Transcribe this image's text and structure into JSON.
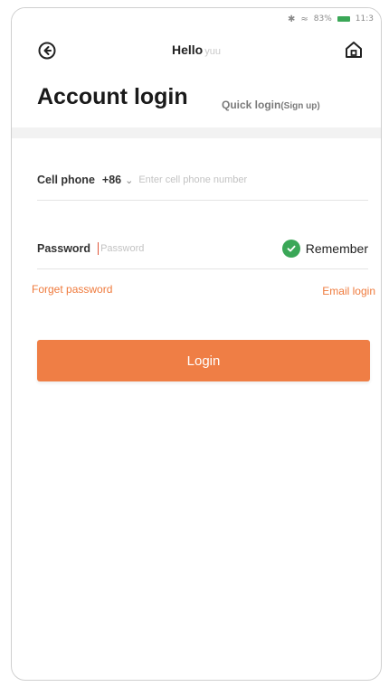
{
  "status_bar": {
    "battery": "83%",
    "time": "11:3"
  },
  "header": {
    "title": "Hello",
    "title_suffix": "yuu",
    "back_icon": "back-circle-icon",
    "home_icon": "home-icon"
  },
  "tabs": {
    "account_login": "Account login",
    "quick_login": "Quick login",
    "quick_login_suffix": "(Sign up)"
  },
  "form": {
    "phone_label": "Cell phone",
    "country_code": "+86",
    "phone_placeholder": "Enter cell phone number",
    "phone_value": "",
    "password_label": "Password",
    "password_placeholder": "Password",
    "password_value": "",
    "remember_label": "Remember",
    "remember_checked": true
  },
  "links": {
    "forget_password": "Forget password",
    "email_login": "Email login"
  },
  "actions": {
    "login_label": "Login"
  },
  "colors": {
    "accent": "#ef7e45",
    "link": "#ef7a3c",
    "check": "#3aa757"
  }
}
